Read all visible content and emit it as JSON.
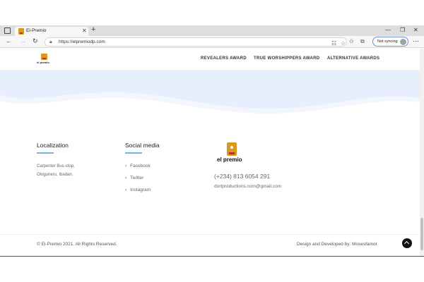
{
  "browser": {
    "tab_title": "El-Premio",
    "url": "https://elpremiodp.com",
    "sync_label": "Not syncing"
  },
  "header": {
    "logo_text": "el premio",
    "nav": [
      {
        "label": "REVEALERS AWARD"
      },
      {
        "label": "TRUE WORSHIPPERS AWARD"
      },
      {
        "label": "ALTERNATIVE AWARDS"
      }
    ]
  },
  "footer": {
    "localization": {
      "title": "Localization",
      "address_line1": "Carpenter Bus-stop,",
      "address_line2": "Ologuneru, Ibadan."
    },
    "social": {
      "title": "Social media",
      "links": [
        {
          "label": "Facebook"
        },
        {
          "label": "Twitter"
        },
        {
          "label": "Instagram"
        }
      ]
    },
    "contact": {
      "logo_text": "el premio",
      "phone": "(+234) 813 6054 291",
      "email": "durtproductions.com@gmail.com"
    },
    "copyright": "© El-Premio 2021. All Rights Reserved.",
    "credit": "Design and Developed by: Mosesfamot"
  },
  "colors": {
    "accent_blue": "#6fb4e3",
    "logo_gold": "#d79a1d",
    "logo_red": "#b2362a",
    "wave_blue": "#e7eefc"
  }
}
